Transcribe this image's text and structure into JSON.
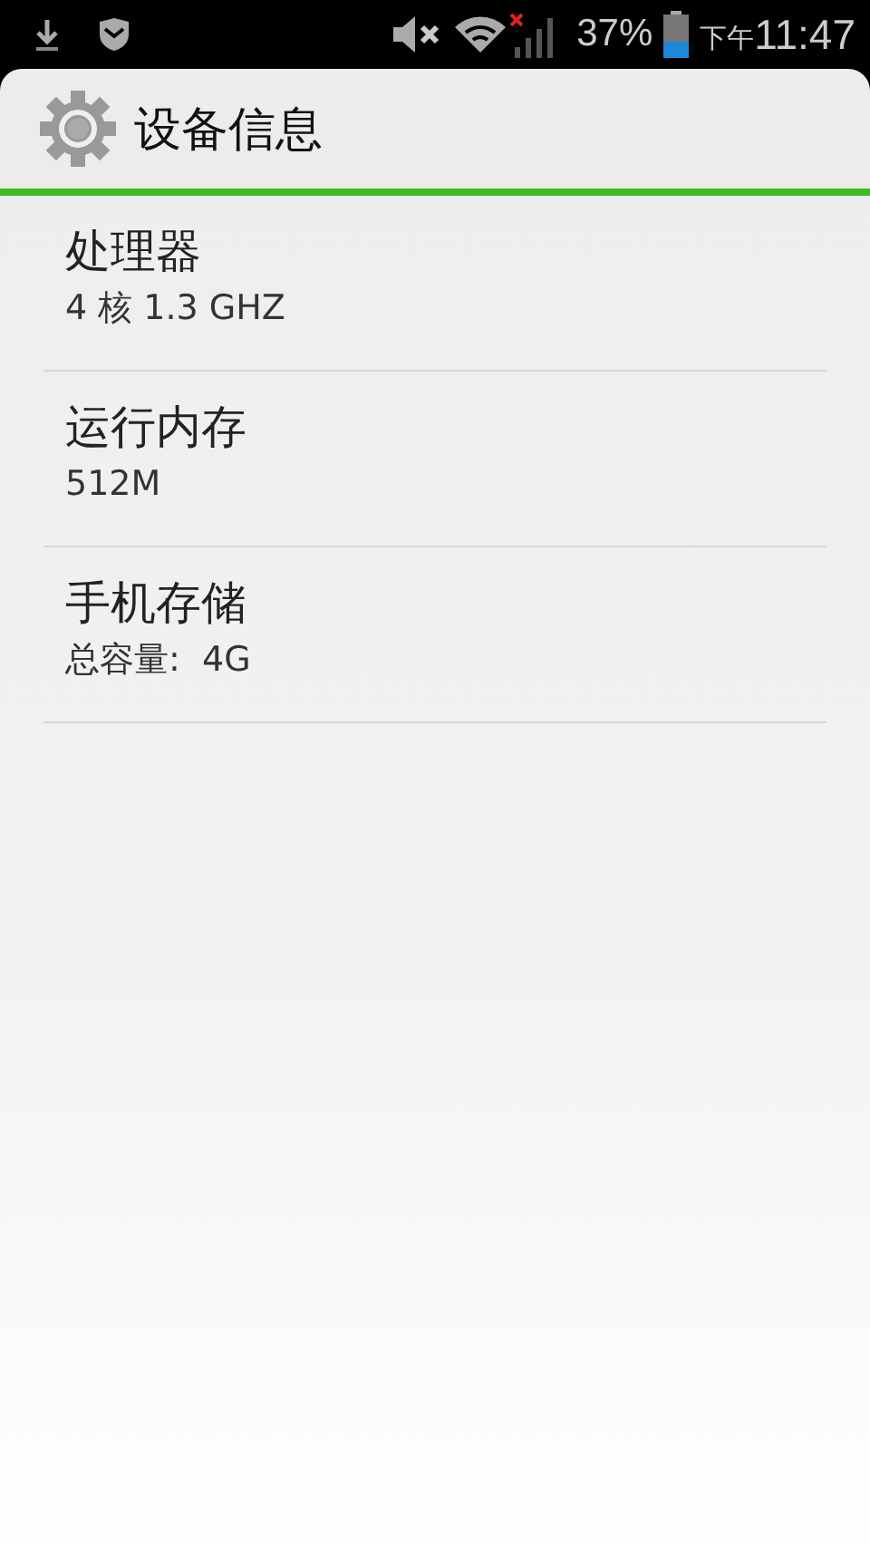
{
  "status_bar": {
    "battery_percent": "37%",
    "time_prefix": "下午",
    "time": "11:47"
  },
  "header": {
    "title": "设备信息"
  },
  "items": [
    {
      "title": "处理器",
      "value": "4 核 1.3 GHZ"
    },
    {
      "title": "运行内存",
      "value": "512M"
    },
    {
      "title": "手机存储",
      "value": "总容量:  4G"
    }
  ]
}
